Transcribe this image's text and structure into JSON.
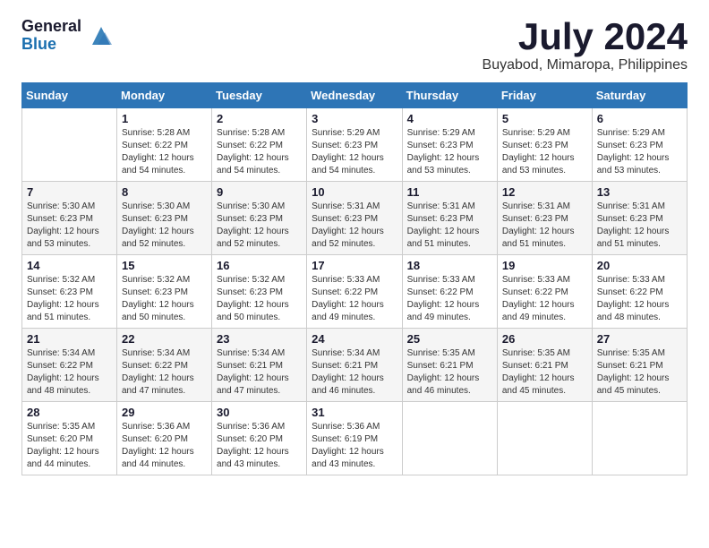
{
  "header": {
    "logo_general": "General",
    "logo_blue": "Blue",
    "month_year": "July 2024",
    "location": "Buyabod, Mimaropa, Philippines"
  },
  "calendar": {
    "days_of_week": [
      "Sunday",
      "Monday",
      "Tuesday",
      "Wednesday",
      "Thursday",
      "Friday",
      "Saturday"
    ],
    "weeks": [
      [
        {
          "day": "",
          "sunrise": "",
          "sunset": "",
          "daylight": ""
        },
        {
          "day": "1",
          "sunrise": "Sunrise: 5:28 AM",
          "sunset": "Sunset: 6:22 PM",
          "daylight": "Daylight: 12 hours and 54 minutes."
        },
        {
          "day": "2",
          "sunrise": "Sunrise: 5:28 AM",
          "sunset": "Sunset: 6:22 PM",
          "daylight": "Daylight: 12 hours and 54 minutes."
        },
        {
          "day": "3",
          "sunrise": "Sunrise: 5:29 AM",
          "sunset": "Sunset: 6:23 PM",
          "daylight": "Daylight: 12 hours and 54 minutes."
        },
        {
          "day": "4",
          "sunrise": "Sunrise: 5:29 AM",
          "sunset": "Sunset: 6:23 PM",
          "daylight": "Daylight: 12 hours and 53 minutes."
        },
        {
          "day": "5",
          "sunrise": "Sunrise: 5:29 AM",
          "sunset": "Sunset: 6:23 PM",
          "daylight": "Daylight: 12 hours and 53 minutes."
        },
        {
          "day": "6",
          "sunrise": "Sunrise: 5:29 AM",
          "sunset": "Sunset: 6:23 PM",
          "daylight": "Daylight: 12 hours and 53 minutes."
        }
      ],
      [
        {
          "day": "7",
          "sunrise": "Sunrise: 5:30 AM",
          "sunset": "Sunset: 6:23 PM",
          "daylight": "Daylight: 12 hours and 53 minutes."
        },
        {
          "day": "8",
          "sunrise": "Sunrise: 5:30 AM",
          "sunset": "Sunset: 6:23 PM",
          "daylight": "Daylight: 12 hours and 52 minutes."
        },
        {
          "day": "9",
          "sunrise": "Sunrise: 5:30 AM",
          "sunset": "Sunset: 6:23 PM",
          "daylight": "Daylight: 12 hours and 52 minutes."
        },
        {
          "day": "10",
          "sunrise": "Sunrise: 5:31 AM",
          "sunset": "Sunset: 6:23 PM",
          "daylight": "Daylight: 12 hours and 52 minutes."
        },
        {
          "day": "11",
          "sunrise": "Sunrise: 5:31 AM",
          "sunset": "Sunset: 6:23 PM",
          "daylight": "Daylight: 12 hours and 51 minutes."
        },
        {
          "day": "12",
          "sunrise": "Sunrise: 5:31 AM",
          "sunset": "Sunset: 6:23 PM",
          "daylight": "Daylight: 12 hours and 51 minutes."
        },
        {
          "day": "13",
          "sunrise": "Sunrise: 5:31 AM",
          "sunset": "Sunset: 6:23 PM",
          "daylight": "Daylight: 12 hours and 51 minutes."
        }
      ],
      [
        {
          "day": "14",
          "sunrise": "Sunrise: 5:32 AM",
          "sunset": "Sunset: 6:23 PM",
          "daylight": "Daylight: 12 hours and 51 minutes."
        },
        {
          "day": "15",
          "sunrise": "Sunrise: 5:32 AM",
          "sunset": "Sunset: 6:23 PM",
          "daylight": "Daylight: 12 hours and 50 minutes."
        },
        {
          "day": "16",
          "sunrise": "Sunrise: 5:32 AM",
          "sunset": "Sunset: 6:23 PM",
          "daylight": "Daylight: 12 hours and 50 minutes."
        },
        {
          "day": "17",
          "sunrise": "Sunrise: 5:33 AM",
          "sunset": "Sunset: 6:22 PM",
          "daylight": "Daylight: 12 hours and 49 minutes."
        },
        {
          "day": "18",
          "sunrise": "Sunrise: 5:33 AM",
          "sunset": "Sunset: 6:22 PM",
          "daylight": "Daylight: 12 hours and 49 minutes."
        },
        {
          "day": "19",
          "sunrise": "Sunrise: 5:33 AM",
          "sunset": "Sunset: 6:22 PM",
          "daylight": "Daylight: 12 hours and 49 minutes."
        },
        {
          "day": "20",
          "sunrise": "Sunrise: 5:33 AM",
          "sunset": "Sunset: 6:22 PM",
          "daylight": "Daylight: 12 hours and 48 minutes."
        }
      ],
      [
        {
          "day": "21",
          "sunrise": "Sunrise: 5:34 AM",
          "sunset": "Sunset: 6:22 PM",
          "daylight": "Daylight: 12 hours and 48 minutes."
        },
        {
          "day": "22",
          "sunrise": "Sunrise: 5:34 AM",
          "sunset": "Sunset: 6:22 PM",
          "daylight": "Daylight: 12 hours and 47 minutes."
        },
        {
          "day": "23",
          "sunrise": "Sunrise: 5:34 AM",
          "sunset": "Sunset: 6:21 PM",
          "daylight": "Daylight: 12 hours and 47 minutes."
        },
        {
          "day": "24",
          "sunrise": "Sunrise: 5:34 AM",
          "sunset": "Sunset: 6:21 PM",
          "daylight": "Daylight: 12 hours and 46 minutes."
        },
        {
          "day": "25",
          "sunrise": "Sunrise: 5:35 AM",
          "sunset": "Sunset: 6:21 PM",
          "daylight": "Daylight: 12 hours and 46 minutes."
        },
        {
          "day": "26",
          "sunrise": "Sunrise: 5:35 AM",
          "sunset": "Sunset: 6:21 PM",
          "daylight": "Daylight: 12 hours and 45 minutes."
        },
        {
          "day": "27",
          "sunrise": "Sunrise: 5:35 AM",
          "sunset": "Sunset: 6:21 PM",
          "daylight": "Daylight: 12 hours and 45 minutes."
        }
      ],
      [
        {
          "day": "28",
          "sunrise": "Sunrise: 5:35 AM",
          "sunset": "Sunset: 6:20 PM",
          "daylight": "Daylight: 12 hours and 44 minutes."
        },
        {
          "day": "29",
          "sunrise": "Sunrise: 5:36 AM",
          "sunset": "Sunset: 6:20 PM",
          "daylight": "Daylight: 12 hours and 44 minutes."
        },
        {
          "day": "30",
          "sunrise": "Sunrise: 5:36 AM",
          "sunset": "Sunset: 6:20 PM",
          "daylight": "Daylight: 12 hours and 43 minutes."
        },
        {
          "day": "31",
          "sunrise": "Sunrise: 5:36 AM",
          "sunset": "Sunset: 6:19 PM",
          "daylight": "Daylight: 12 hours and 43 minutes."
        },
        {
          "day": "",
          "sunrise": "",
          "sunset": "",
          "daylight": ""
        },
        {
          "day": "",
          "sunrise": "",
          "sunset": "",
          "daylight": ""
        },
        {
          "day": "",
          "sunrise": "",
          "sunset": "",
          "daylight": ""
        }
      ]
    ]
  }
}
